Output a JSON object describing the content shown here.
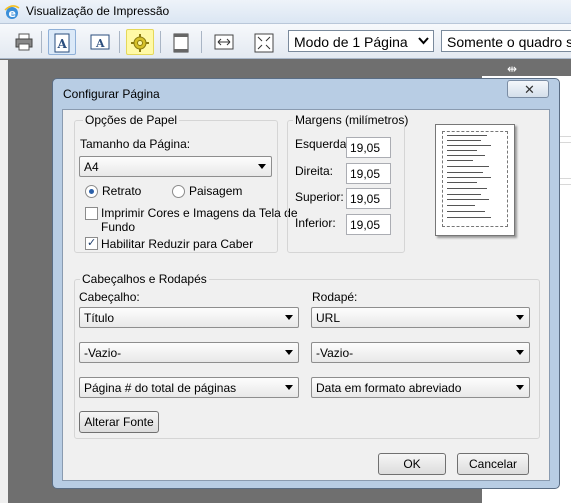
{
  "window": {
    "title": "Visualização de Impressão"
  },
  "toolbar": {
    "page_mode": "Modo de 1 Página",
    "frames_mode": "Somente o quadro se"
  },
  "dialog": {
    "title": "Configurar Página",
    "paper_options": {
      "legend": "Opções de Papel",
      "size_label": "Tamanho da Página:",
      "size_value": "A4",
      "portrait_label": "Retrato",
      "landscape_label": "Paisagem",
      "orientation_selected": "Retrato",
      "print_bg_label_1": "Imprimir Cores e Imagens da Tela de",
      "print_bg_label_2": "Fundo",
      "print_bg_checked": false,
      "shrink_label": "Habilitar Reduzir para Caber",
      "shrink_checked": true
    },
    "margins": {
      "legend": "Margens (milímetros)",
      "left_label": "Esquerda:",
      "left_value": "19,05",
      "right_label": "Direita:",
      "right_value": "19,05",
      "top_label": "Superior:",
      "top_value": "19,05",
      "bottom_label": "Inferior:",
      "bottom_value": "19,05"
    },
    "headers_footers": {
      "legend": "Cabeçalhos e Rodapés",
      "header_label": "Cabeçalho:",
      "footer_label": "Rodapé:",
      "header_1": "Título",
      "header_2": "-Vazio-",
      "header_3": "Página # do total de páginas",
      "footer_1": "URL",
      "footer_2": "-Vazio-",
      "footer_3": "Data em formato abreviado",
      "font_button": "Alterar Fonte"
    },
    "ok_button": "OK",
    "cancel_button": "Cancelar"
  }
}
